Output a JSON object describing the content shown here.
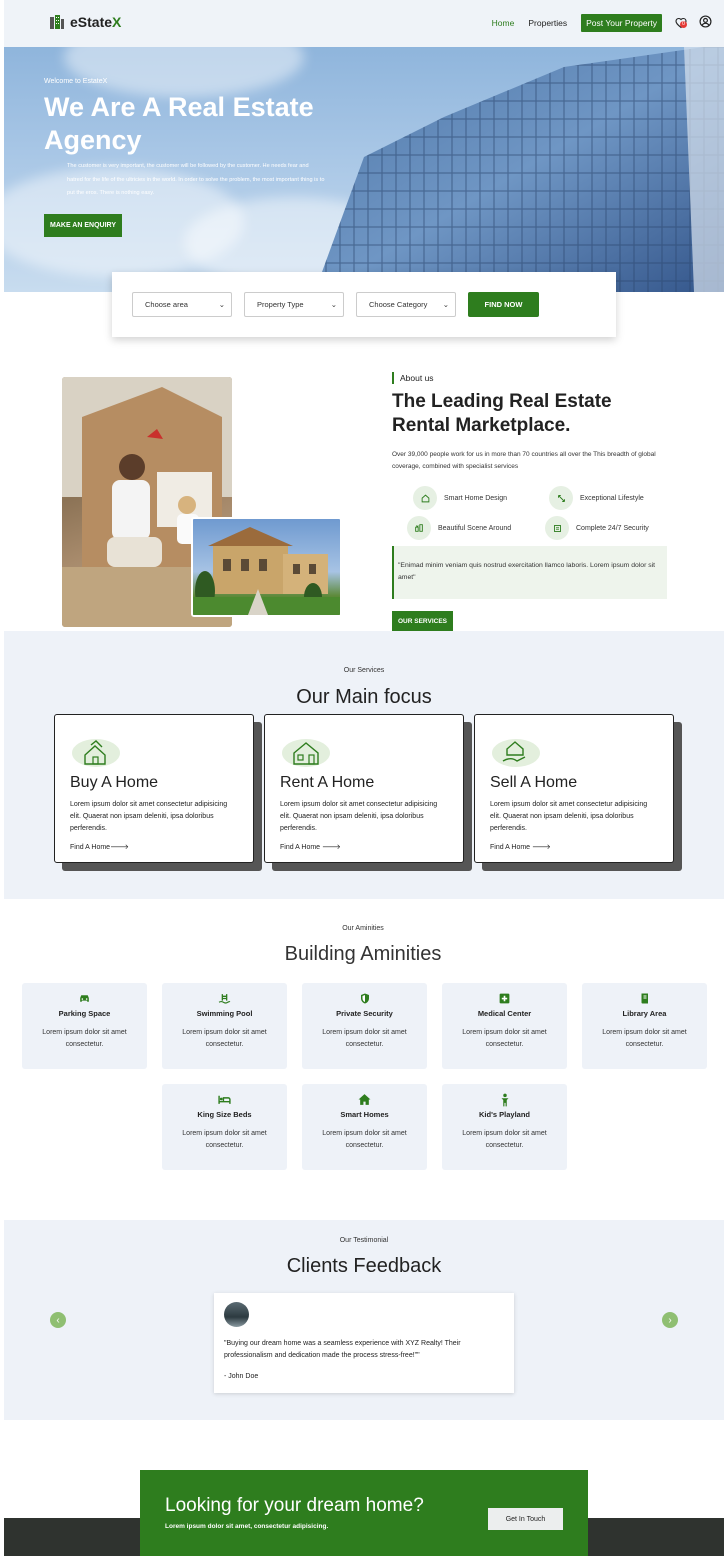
{
  "colors": {
    "brand_green": "#2e7d1e",
    "light_bg": "#eef2f8",
    "dark_footer": "#2f332f"
  },
  "header": {
    "logo_left": "eState",
    "logo_accent": "X",
    "nav": {
      "home": "Home",
      "properties": "Properties",
      "post": "Post Your Property"
    },
    "wishlist_count": "0",
    "icons": [
      "building-logo-icon",
      "heart-icon",
      "user-icon"
    ]
  },
  "hero": {
    "welcome": "Welcome to EstateX",
    "title": "We Are A Real Estate Agency",
    "description": "The customer is very important, the customer will be followed by the customer. He needs fear and hatred for the life of the ultricies in the world. In order to solve the problem, the most important thing is to put the eros. There is nothing easy.",
    "cta": "MAKE AN ENQUIRY"
  },
  "search": {
    "area": "Choose area",
    "type": "Property Type",
    "category": "Choose Category",
    "button": "FIND NOW"
  },
  "about": {
    "label": "About us",
    "title": "The Leading Real Estate Rental Marketplace.",
    "description": "Over 39,000 people work for us in more than 70 countries all over the This breadth of global coverage, combined with specialist services",
    "features": [
      {
        "label": "Smart Home Design",
        "icon": "home-icon"
      },
      {
        "label": "Exceptional Lifestyle",
        "icon": "expand-icon"
      },
      {
        "label": "Beautiful Scene Around",
        "icon": "scene-icon"
      },
      {
        "label": "Complete 24/7 Security",
        "icon": "security-icon"
      }
    ],
    "quote": "\"Enimad minim veniam quis nostrud exercitation llamco laboris. Lorem ipsum dolor sit amet\"",
    "button": "OUR SERVICES"
  },
  "services": {
    "subtitle": "Our Services",
    "title": "Our Main focus",
    "cards": [
      {
        "title": "Buy A Home",
        "text": "Lorem ipsum dolor sit amet consectetur adipisicing elit. Quaerat non ipsam deleniti, ipsa doloribus perferendis.",
        "link": "Find A Home🡒",
        "icon": "buy-home-icon"
      },
      {
        "title": "Rent A Home",
        "text": "Lorem ipsum dolor sit amet consectetur adipisicing elit. Quaerat non ipsam deleniti, ipsa doloribus perferendis.",
        "link": "Find A Home 🡒",
        "icon": "rent-home-icon"
      },
      {
        "title": "Sell A Home",
        "text": "Lorem ipsum dolor sit amet consectetur adipisicing elit. Quaerat non ipsam deleniti, ipsa doloribus perferendis.",
        "link": "Find A Home 🡒",
        "icon": "sell-home-icon"
      }
    ]
  },
  "amenities": {
    "subtitle": "Our Aminities",
    "title": "Building Aminities",
    "items": [
      {
        "name": "Parking Space",
        "text": "Lorem ipsum dolor sit amet consectetur.",
        "icon": "car-icon"
      },
      {
        "name": "Swimming Pool",
        "text": "Lorem ipsum dolor sit amet consectetur.",
        "icon": "pool-icon"
      },
      {
        "name": "Private Security",
        "text": "Lorem ipsum dolor sit amet consectetur.",
        "icon": "shield-icon"
      },
      {
        "name": "Medical Center",
        "text": "Lorem ipsum dolor sit amet consectetur.",
        "icon": "medical-icon"
      },
      {
        "name": "Library Area",
        "text": "Lorem ipsum dolor sit amet consectetur.",
        "icon": "book-icon"
      },
      {
        "name": "King Size Beds",
        "text": "Lorem ipsum dolor sit amet consectetur.",
        "icon": "bed-icon"
      },
      {
        "name": "Smart Homes",
        "text": "Lorem ipsum dolor sit amet consectetur.",
        "icon": "house-icon"
      },
      {
        "name": "Kid's Playland",
        "text": "Lorem ipsum dolor sit amet consectetur.",
        "icon": "child-icon"
      }
    ]
  },
  "testimonial": {
    "subtitle": "Our Testimonial",
    "title": "Clients Feedback",
    "quote": "\"Buying our dream home was a seamless experience with XYZ Realty! Their professionalism and dedication made the process stress-free!\"\"",
    "author": "- John Doe"
  },
  "cta": {
    "title": "Looking for your dream home?",
    "subtitle": "Lorem ipsum dolor sit amet, consectetur adipisicing.",
    "button": "Get In Touch"
  }
}
